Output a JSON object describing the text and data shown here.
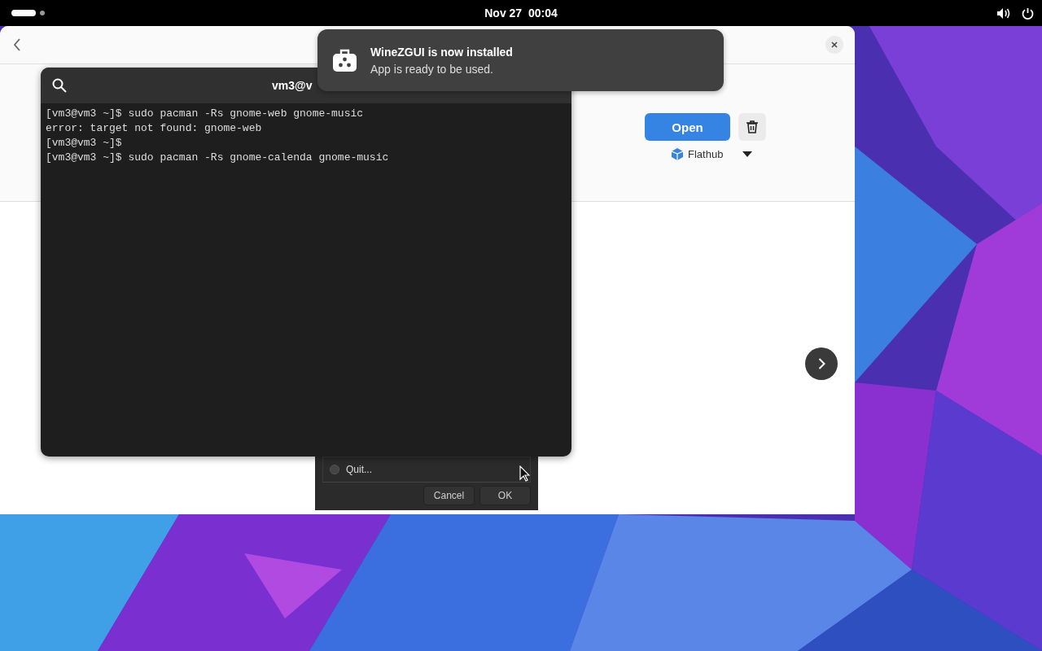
{
  "top_bar": {
    "clock": "Nov 27  00:04"
  },
  "software_window": {
    "open_button": "Open",
    "source": "Flathub"
  },
  "terminal": {
    "title": "vm3@v",
    "lines": [
      "[vm3@vm3 ~]$ sudo pacman -Rs gnome-web gnome-music",
      "error: target not found: gnome-web",
      "[vm3@vm3 ~]$",
      "[vm3@vm3 ~]$ sudo pacman -Rs gnome-calenda gnome-music"
    ]
  },
  "dialog": {
    "options": [
      {
        "label": "Quit...",
        "selected": false
      }
    ],
    "buttons": [
      "Cancel",
      "OK"
    ]
  },
  "notification": {
    "title": "WineZGUI is now installed",
    "body": "App is ready to be used."
  }
}
